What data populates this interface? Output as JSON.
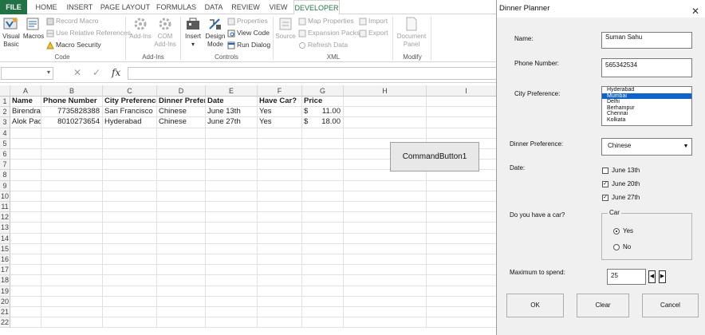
{
  "ribbon": {
    "tabs": [
      "FILE",
      "HOME",
      "INSERT",
      "PAGE LAYOUT",
      "FORMULAS",
      "DATA",
      "REVIEW",
      "VIEW",
      "DEVELOPER"
    ],
    "code": {
      "visual_basic": "Visual Basic",
      "macros": "Macros",
      "record_macro": "Record Macro",
      "relative_refs": "Use Relative References",
      "macro_security": "Macro Security",
      "label": "Code"
    },
    "addins": {
      "addins": "Add-Ins",
      "com_addins": "COM Add-Ins",
      "label": "Add-Ins"
    },
    "controls": {
      "insert": "Insert",
      "design_mode": "Design Mode",
      "properties": "Properties",
      "view_code": "View Code",
      "run_dialog": "Run Dialog",
      "label": "Controls"
    },
    "xml": {
      "source": "Source",
      "map_properties": "Map Properties",
      "expansion_packs": "Expansion Packs",
      "refresh_data": "Refresh Data",
      "import": "Import",
      "export": "Export",
      "label": "XML"
    },
    "modify": {
      "document_panel": "Document Panel",
      "label": "Modify"
    }
  },
  "formula_bar": {
    "fx": "fx",
    "name_box": "",
    "value": ""
  },
  "sheet": {
    "columns": [
      "A",
      "B",
      "C",
      "D",
      "E",
      "F",
      "G",
      "H",
      "I"
    ],
    "rows": [
      "1",
      "2",
      "3",
      "4",
      "5",
      "6",
      "7",
      "8",
      "9",
      "10",
      "11",
      "12",
      "13",
      "14",
      "15",
      "16",
      "17",
      "18",
      "19",
      "20",
      "21",
      "22"
    ],
    "headers": [
      "Name",
      "Phone Number",
      "City Preference",
      "Dinner Preference",
      "Date",
      "Have Car?",
      "Price"
    ],
    "data": [
      [
        "Birendra Pradhan",
        "7735828388",
        "San Francisco",
        "Chinese",
        "June 13th",
        "Yes",
        "$",
        "11.00"
      ],
      [
        "Alok Padhi",
        "8010273654",
        "Hyderabad",
        "Chinese",
        "June 27th",
        "Yes",
        "$",
        "18.00"
      ]
    ],
    "command_button": "CommandButton1"
  },
  "dialog": {
    "title": "Dinner Planner",
    "close": "✕",
    "name_label": "Name:",
    "name_value": "Suman Sahu",
    "phone_label": "Phone Number:",
    "phone_value": "565342534",
    "city_label": "City Preference:",
    "cities": [
      "Hyderabad",
      "Mumbai",
      "Delhi",
      "Berhampur",
      "Chennai",
      "Kolkata"
    ],
    "city_selected": "Mumbai",
    "dinner_label": "Dinner Preference:",
    "dinner_value": "Chinese",
    "date_label": "Date:",
    "dates": [
      {
        "label": "June 13th",
        "checked": false
      },
      {
        "label": "June 20th",
        "checked": true
      },
      {
        "label": "June 27th",
        "checked": true
      }
    ],
    "car_label": "Do you have a car?",
    "car_frame": "Car",
    "car_yes": "Yes",
    "car_no": "No",
    "car_value": "Yes",
    "max_label": "Maximum to spend:",
    "max_value": "25",
    "ok": "OK",
    "clear": "Clear",
    "cancel": "Cancel"
  },
  "colors": {
    "excel_green": "#217346",
    "selection_blue": "#0a64d2"
  }
}
